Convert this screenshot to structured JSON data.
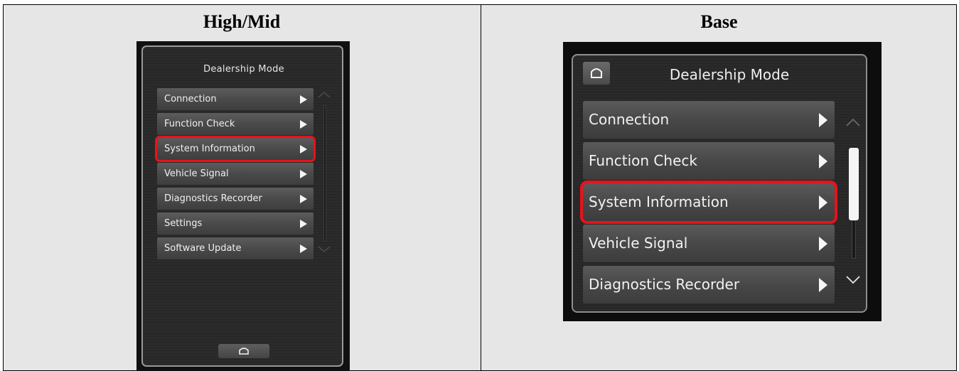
{
  "columns": {
    "left_title": "High/Mid",
    "right_title": "Base"
  },
  "high_mid": {
    "screen_title": "Dealership Mode",
    "items": [
      {
        "label": "Connection"
      },
      {
        "label": "Function Check"
      },
      {
        "label": "System Information",
        "highlighted": true
      },
      {
        "label": "Vehicle Signal"
      },
      {
        "label": "Diagnostics Recorder"
      },
      {
        "label": "Settings"
      },
      {
        "label": "Software Update"
      }
    ],
    "icons": [
      "home-icon",
      "chevron-up-icon",
      "chevron-down-icon",
      "play-arrow-icon"
    ]
  },
  "base": {
    "screen_title": "Dealership Mode",
    "items": [
      {
        "label": "Connection"
      },
      {
        "label": "Function Check"
      },
      {
        "label": "System Information",
        "highlighted": true
      },
      {
        "label": "Vehicle Signal"
      },
      {
        "label": "Diagnostics Recorder"
      }
    ],
    "icons": [
      "home-icon",
      "chevron-up-icon",
      "chevron-down-icon",
      "play-arrow-icon"
    ]
  },
  "colors": {
    "highlight": "#e8121b",
    "table_bg": "#e6e6e6",
    "screen_bg": "#111111"
  }
}
